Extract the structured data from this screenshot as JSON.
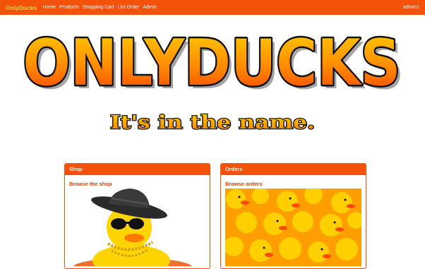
{
  "navbar": {
    "brand": "OnlyDucks",
    "links": [
      "Home",
      "Products",
      "Shopping Cart",
      "List Order",
      "Admin"
    ],
    "user": "admin1"
  },
  "hero": {
    "logo_text": "ONLYDUCKS",
    "tagline": "It's in the name."
  },
  "cards": {
    "shop": {
      "title": "Shop",
      "link": "Browse the shop"
    },
    "orders": {
      "title": "Orders",
      "link": "Browse orders"
    }
  },
  "colors": {
    "primary": "#f4510b",
    "brand_text": "#ffd54a",
    "logo_gradient_top": "#ffd200",
    "logo_gradient_bottom": "#f43a00",
    "outline": "#111111"
  }
}
